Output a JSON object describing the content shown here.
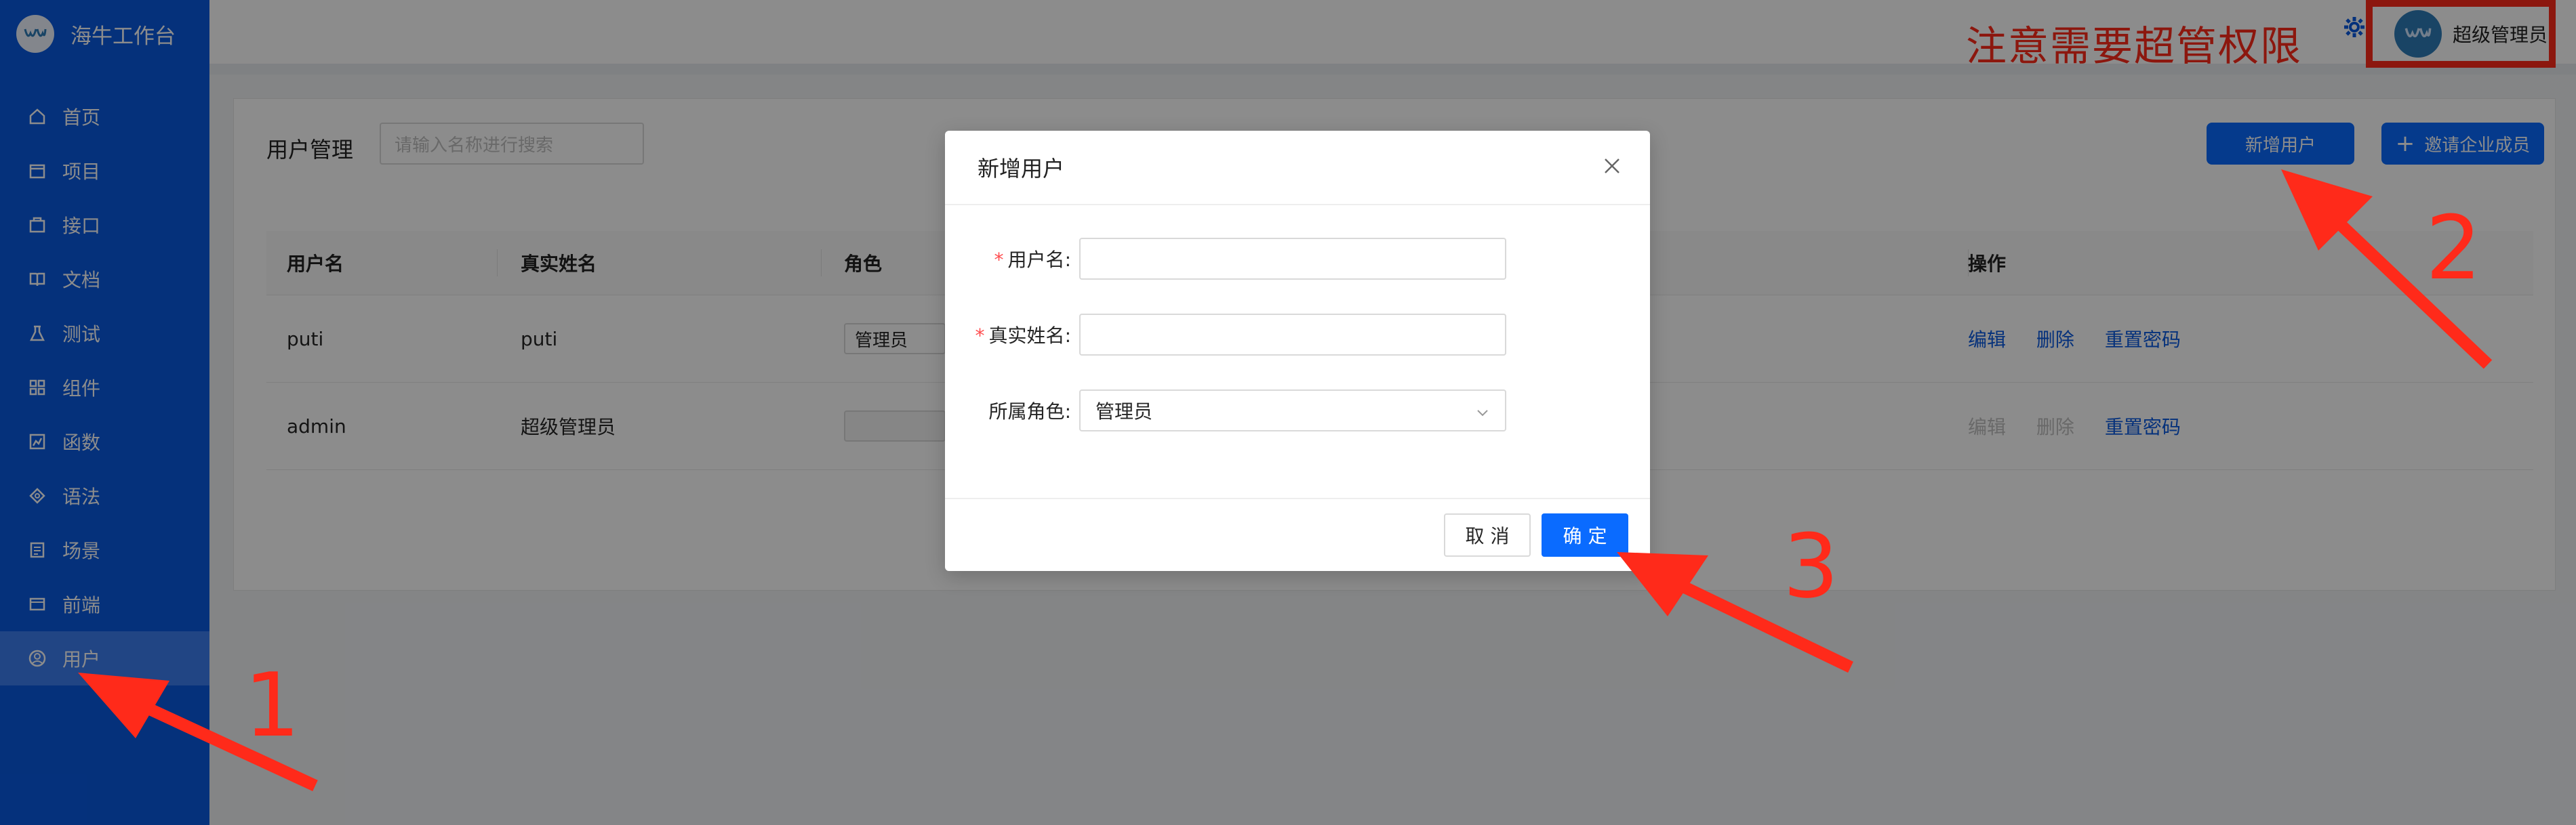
{
  "sidebar": {
    "brand": "海牛工作台",
    "items": [
      {
        "label": "首页",
        "icon": "home-icon"
      },
      {
        "label": "项目",
        "icon": "project-icon"
      },
      {
        "label": "接口",
        "icon": "api-icon"
      },
      {
        "label": "文档",
        "icon": "book-icon"
      },
      {
        "label": "测试",
        "icon": "flask-icon"
      },
      {
        "label": "组件",
        "icon": "grid-icon"
      },
      {
        "label": "函数",
        "icon": "function-icon"
      },
      {
        "label": "语法",
        "icon": "tag-icon"
      },
      {
        "label": "场景",
        "icon": "scene-icon"
      },
      {
        "label": "前端",
        "icon": "web-icon"
      },
      {
        "label": "用户",
        "icon": "user-icon"
      }
    ],
    "active_index": 10
  },
  "header": {
    "notice": "注意需要超管权限",
    "user_name": "超级管理员"
  },
  "page": {
    "title": "用户管理",
    "search_placeholder": "请输入名称进行搜索",
    "add_user_label": "新增用户",
    "invite_label": "邀请企业成员"
  },
  "table": {
    "headers": {
      "username": "用户名",
      "realname": "真实姓名",
      "role": "角色",
      "actions": "操作"
    },
    "rows": [
      {
        "username": "puti",
        "realname": "puti",
        "role": "管理员",
        "edit": "编辑",
        "delete": "删除",
        "reset": "重置密码"
      },
      {
        "username": "admin",
        "realname": "超级管理员",
        "role": "",
        "edit": "编辑",
        "delete": "删除",
        "reset": "重置密码"
      }
    ]
  },
  "modal": {
    "title": "新增用户",
    "fields": {
      "username_label": "用户名",
      "realname_label": "真实姓名",
      "role_label": "所属角色",
      "role_value": "管理员",
      "username_value": "",
      "realname_value": ""
    },
    "cancel_label": "取 消",
    "ok_label": "确 定"
  },
  "annotations": {
    "step1": "1",
    "step2": "2",
    "step3": "3",
    "color": "#ff2a1a"
  },
  "colors": {
    "sidebar": "#0a5ae1",
    "primary": "#0a6bff"
  }
}
